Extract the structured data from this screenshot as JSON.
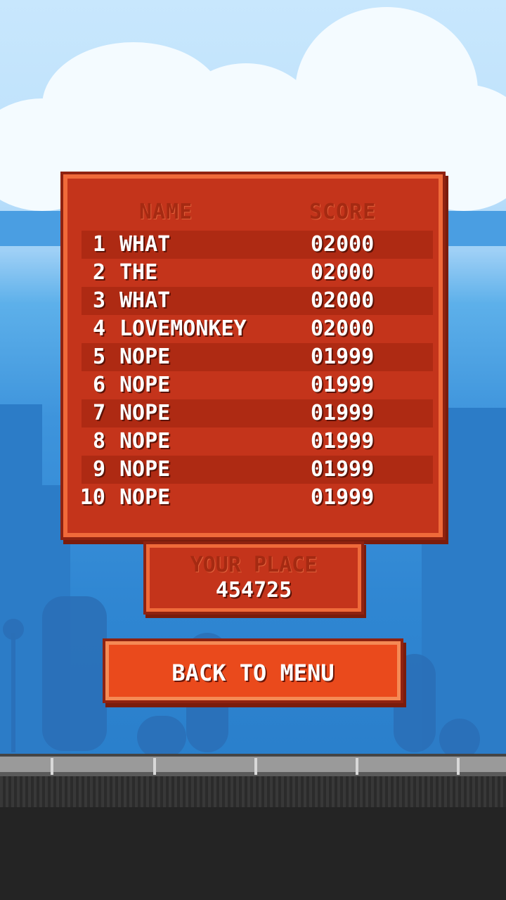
{
  "leaderboard": {
    "header": {
      "name": "NAME",
      "score": "SCORE"
    },
    "rows": [
      {
        "rank": "1",
        "name": "WHAT",
        "score": "02000"
      },
      {
        "rank": "2",
        "name": "THE",
        "score": "02000"
      },
      {
        "rank": "3",
        "name": "WHAT",
        "score": "02000"
      },
      {
        "rank": "4",
        "name": "LOVEMONKEY",
        "score": "02000"
      },
      {
        "rank": "5",
        "name": "NOPE",
        "score": "01999"
      },
      {
        "rank": "6",
        "name": "NOPE",
        "score": "01999"
      },
      {
        "rank": "7",
        "name": "NOPE",
        "score": "01999"
      },
      {
        "rank": "8",
        "name": "NOPE",
        "score": "01999"
      },
      {
        "rank": "9",
        "name": "NOPE",
        "score": "01999"
      },
      {
        "rank": "10",
        "name": "NOPE",
        "score": "01999"
      }
    ]
  },
  "your_place": {
    "label": "YOUR PLACE",
    "value": "454725"
  },
  "back_button": {
    "label": "BACK TO MENU"
  },
  "colors": {
    "panel": "#c4341b",
    "panel_border": "#8f2210",
    "button": "#ea4a1c",
    "header_text": "#a52a12",
    "sky": "#3e94dc"
  }
}
